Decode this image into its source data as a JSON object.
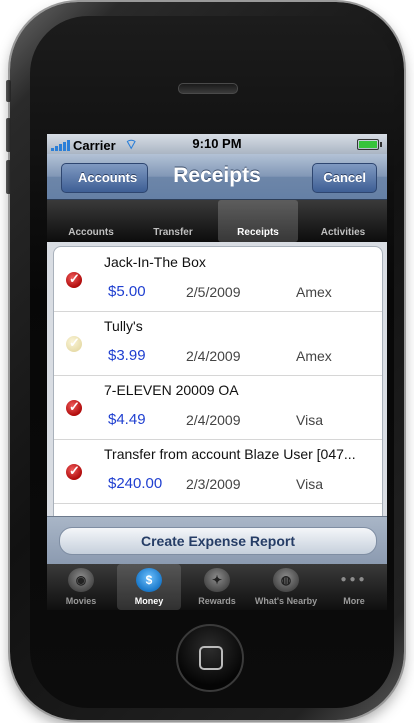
{
  "status": {
    "carrier": "Carrier",
    "time": "9:10 PM"
  },
  "navbar": {
    "title": "Receipts",
    "back_label": "Accounts",
    "cancel_label": "Cancel"
  },
  "segments": [
    {
      "label": "Accounts"
    },
    {
      "label": "Transfer"
    },
    {
      "label": "Receipts"
    },
    {
      "label": "Activities"
    }
  ],
  "receipts": [
    {
      "name": "Jack-In-The Box",
      "amount": "$5.00",
      "date": "2/5/2009",
      "card": "Amex",
      "checked": true
    },
    {
      "name": "Tully's",
      "amount": "$3.99",
      "date": "2/4/2009",
      "card": "Amex",
      "checked": false
    },
    {
      "name": "7-ELEVEN 20009 OA",
      "amount": "$4.49",
      "date": "2/4/2009",
      "card": "Visa",
      "checked": true
    },
    {
      "name": "Transfer from account Blaze User [047...",
      "amount": "$240.00",
      "date": "2/3/2009",
      "card": "Visa",
      "checked": true
    }
  ],
  "action": {
    "create_label": "Create Expense Report"
  },
  "tabs": [
    {
      "label": "Movies",
      "icon": "film-reel-icon"
    },
    {
      "label": "Money",
      "icon": "dollar-coin-icon"
    },
    {
      "label": "Rewards",
      "icon": "gift-icon"
    },
    {
      "label": "What's Nearby",
      "icon": "globe-icon"
    },
    {
      "label": "More",
      "icon": "more-dots-icon"
    }
  ]
}
